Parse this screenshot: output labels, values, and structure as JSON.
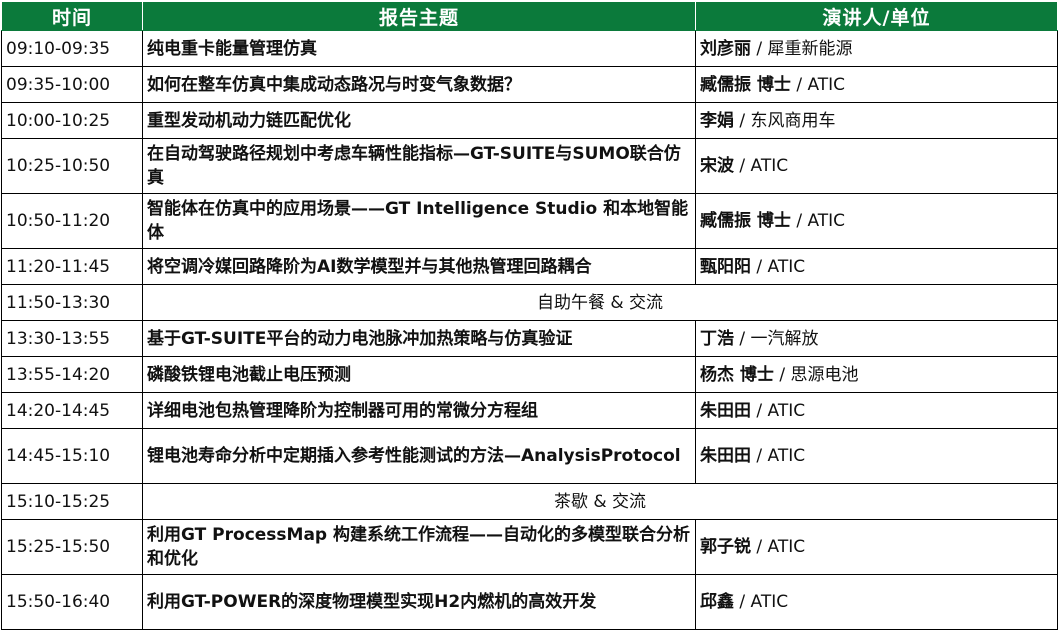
{
  "header": {
    "time": "时间",
    "topic": "报告主题",
    "speaker": "演讲人/单位"
  },
  "rows": [
    {
      "time": "09:10-09:35",
      "topic": "纯电重卡能量管理仿真",
      "name": "刘彦丽",
      "org": " / 犀重新能源"
    },
    {
      "time": "09:35-10:00",
      "topic": "如何在整车仿真中集成动态路况与时变气象数据？",
      "name": "臧儒振 博士",
      "org": " / ATIC"
    },
    {
      "time": "10:00-10:25",
      "topic": "重型发动机动力链匹配优化",
      "name": "李娟",
      "org": " / 东风商用车"
    },
    {
      "time": "10:25-10:50",
      "topic": "在自动驾驶路径规划中考虑车辆性能指标—GT-SUITE与SUMO联合仿真",
      "name": "宋波",
      "org": " / ATIC"
    },
    {
      "time": "10:50-11:20",
      "topic": "智能体在仿真中的应用场景——GT Intelligence Studio 和本地智能体",
      "name": "臧儒振 博士",
      "org": " / ATIC"
    },
    {
      "time": "11:20-11:45",
      "topic": "将空调冷媒回路降阶为AI数学模型并与其他热管理回路耦合",
      "name": "甄阳阳",
      "org": " / ATIC"
    },
    {
      "time": "11:50-13:30",
      "break": "自助午餐 & 交流"
    },
    {
      "time": "13:30-13:55",
      "topic": "基于GT-SUITE平台的动力电池脉冲加热策略与仿真验证",
      "name": "丁浩",
      "org": " / 一汽解放"
    },
    {
      "time": "13:55-14:20",
      "topic": "磷酸铁锂电池截止电压预测",
      "name": "杨杰 博士",
      "org": " / 思源电池"
    },
    {
      "time": "14:20-14:45",
      "topic": "详细电池包热管理降阶为控制器可用的常微分方程组",
      "name": "朱田田",
      "org": " / ATIC"
    },
    {
      "time": "14:45-15:10",
      "topic": "锂电池寿命分析中定期插入参考性能测试的方法—AnalysisProtocol",
      "name": "朱田田",
      "org": " / ATIC"
    },
    {
      "time": "15:10-15:25",
      "break": "茶歇 & 交流"
    },
    {
      "time": "15:25-15:50",
      "topic": "利用GT ProcessMap 构建系统工作流程——自动化的多模型联合分析和优化",
      "name": "郭子锐",
      "org": " / ATIC"
    },
    {
      "time": "15:50-16:40",
      "topic": "利用GT-POWER的深度物理模型实现H2内燃机的高效开发",
      "name": "邱鑫",
      "org": " / ATIC"
    }
  ],
  "colors": {
    "header_bg": "#0b7a3b",
    "header_text": "#ffffff"
  }
}
